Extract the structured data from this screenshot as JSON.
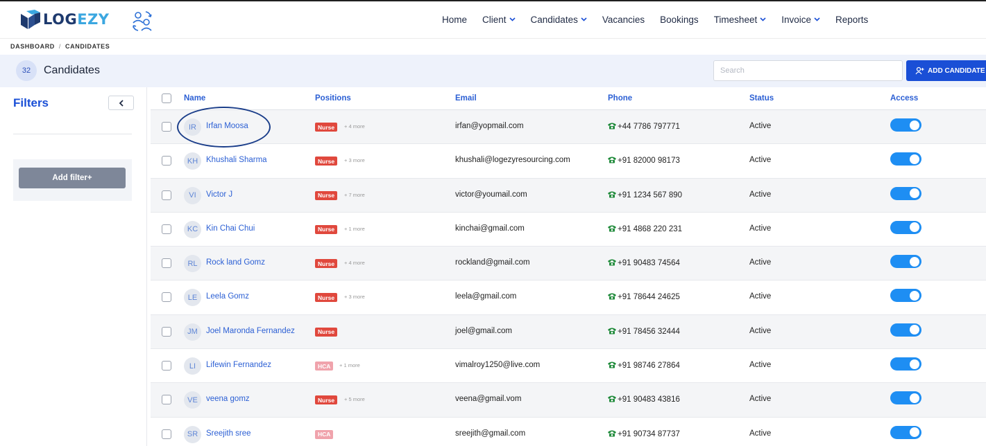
{
  "app": {
    "logo_text_a": "LOG",
    "logo_text_b": "EZY"
  },
  "nav": [
    {
      "label": "Home",
      "dropdown": false
    },
    {
      "label": "Client",
      "dropdown": true
    },
    {
      "label": "Candidates",
      "dropdown": true
    },
    {
      "label": "Vacancies",
      "dropdown": false
    },
    {
      "label": "Bookings",
      "dropdown": false
    },
    {
      "label": "Timesheet",
      "dropdown": true
    },
    {
      "label": "Invoice",
      "dropdown": true
    },
    {
      "label": "Reports",
      "dropdown": false
    }
  ],
  "breadcrumb": {
    "root": "DASHBOARD",
    "separator": "/",
    "current": "CANDIDATES"
  },
  "header": {
    "count": "32",
    "title": "Candidates",
    "search_placeholder": "Search",
    "add_button_label": "ADD CANDIDATE"
  },
  "filters": {
    "title": "Filters",
    "add_filter_label": "Add filter+"
  },
  "table": {
    "columns": {
      "name": "Name",
      "positions": "Positions",
      "email": "Email",
      "phone": "Phone",
      "status": "Status",
      "access": "Access"
    },
    "rows": [
      {
        "initials": "IR",
        "name": "Irfan Moosa",
        "position": "Nurse",
        "position_type": "nurse",
        "more": "+ 4 more",
        "email": "irfan@yopmail.com",
        "phone": "+44 7786 797771",
        "status": "Active",
        "access": true
      },
      {
        "initials": "KH",
        "name": "Khushali Sharma",
        "position": "Nurse",
        "position_type": "nurse",
        "more": "+ 3 more",
        "email": "khushali@logezyresourcing.com",
        "phone": "+91 82000 98173",
        "status": "Active",
        "access": true
      },
      {
        "initials": "VI",
        "name": "Victor J",
        "position": "Nurse",
        "position_type": "nurse",
        "more": "+ 7 more",
        "email": "victor@youmail.com",
        "phone": "+91 1234 567 890",
        "status": "Active",
        "access": true
      },
      {
        "initials": "KC",
        "name": "Kin Chai Chui",
        "position": "Nurse",
        "position_type": "nurse",
        "more": "+ 1 more",
        "email": "kinchai@gmail.com",
        "phone": "+91 4868 220 231",
        "status": "Active",
        "access": true
      },
      {
        "initials": "RL",
        "name": "Rock land Gomz",
        "position": "Nurse",
        "position_type": "nurse",
        "more": "+ 4 more",
        "email": "rockland@gmail.com",
        "phone": "+91 90483 74564",
        "status": "Active",
        "access": true
      },
      {
        "initials": "LE",
        "name": "Leela Gomz",
        "position": "Nurse",
        "position_type": "nurse",
        "more": "+ 3 more",
        "email": "leela@gmail.com",
        "phone": "+91 78644 24625",
        "status": "Active",
        "access": true
      },
      {
        "initials": "JM",
        "name": "Joel Maronda Fernandez",
        "position": "Nurse",
        "position_type": "nurse",
        "more": "",
        "email": "joel@gmail.com",
        "phone": "+91 78456 32444",
        "status": "Active",
        "access": true
      },
      {
        "initials": "LI",
        "name": "Lifewin Fernandez",
        "position": "HCA",
        "position_type": "hca",
        "more": "+ 1 more",
        "email": "vimalroy1250@live.com",
        "phone": "+91 98746 27864",
        "status": "Active",
        "access": true
      },
      {
        "initials": "VE",
        "name": "veena gomz",
        "position": "Nurse",
        "position_type": "nurse",
        "more": "+ 5 more",
        "email": "veena@gmail.vom",
        "phone": "+91 90483 43816",
        "status": "Active",
        "access": true
      },
      {
        "initials": "SR",
        "name": "Sreejith sree",
        "position": "HCA",
        "position_type": "hca",
        "more": "",
        "email": "sreejith@gmail.com",
        "phone": "+91 90734 87737",
        "status": "Active",
        "access": true
      }
    ]
  },
  "colors": {
    "primary": "#1a4fd6",
    "toggle_on": "#1e8ef3",
    "nurse_badge": "#e0483d",
    "hca_badge": "#f0a3ac",
    "phone_icon": "#1f8a3a"
  }
}
